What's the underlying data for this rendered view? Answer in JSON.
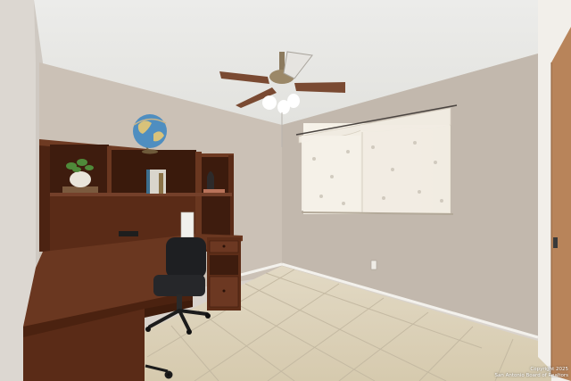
{
  "photo": {
    "subject": "bedroom-office",
    "watermark": {
      "line1": "Copyright 2025",
      "line2": "San Antonio Board of Realtors"
    }
  },
  "palette": {
    "ceiling": "#e9e9e7",
    "back_wall": "#cbc1b6",
    "right_wall": "#c2b8ad",
    "left_wall": "#ddd8d2",
    "floor": "#ddd3bd",
    "grout": "#c4b9a2",
    "desk": "#5e2e19",
    "desk_top": "#6a3720",
    "door": "#b8845a",
    "curtain": "#f0ebe1",
    "fan_blade": "#7a4a32",
    "globe": "#4f8ec0"
  }
}
